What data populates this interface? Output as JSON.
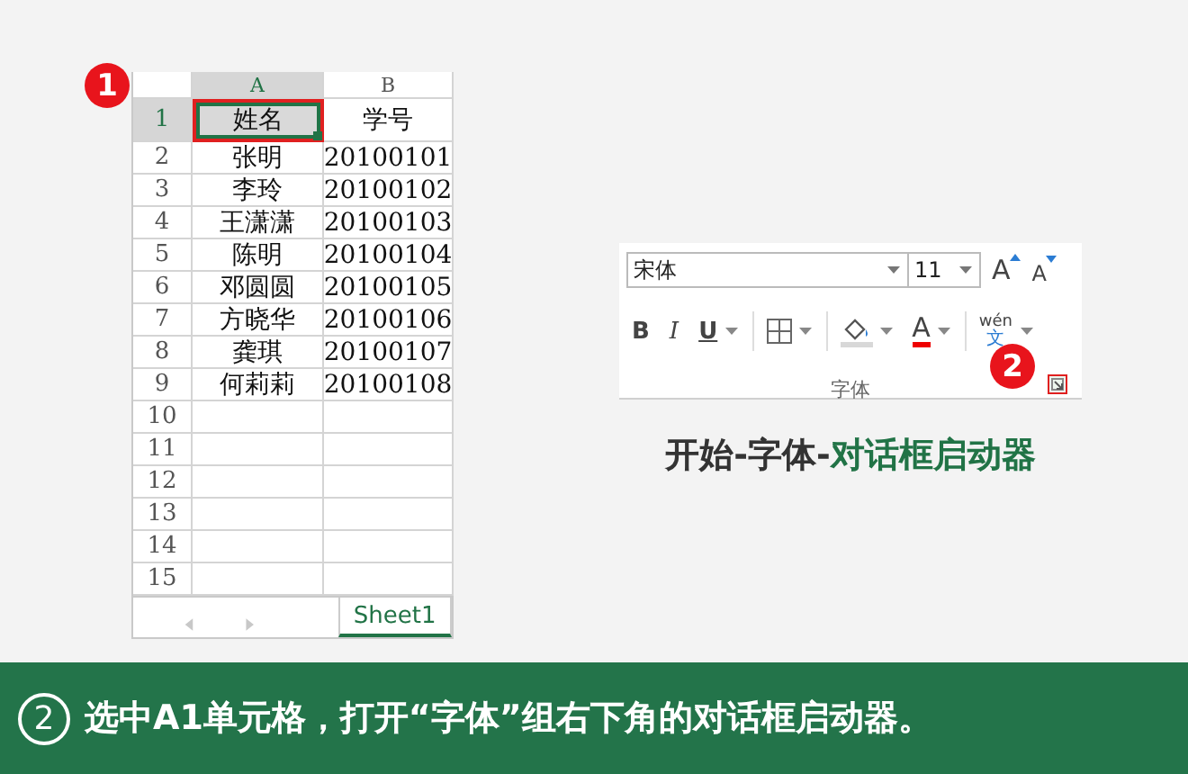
{
  "spreadsheet": {
    "columns": [
      {
        "label": "A",
        "selected": true
      },
      {
        "label": "B",
        "selected": false
      }
    ],
    "rows": [
      {
        "number": "1",
        "selected": true,
        "cells": [
          {
            "text": "姓名",
            "selected": true
          },
          {
            "text": "学号",
            "selected": false
          }
        ]
      },
      {
        "number": "2",
        "selected": false,
        "cells": [
          {
            "text": "张明",
            "selected": false
          },
          {
            "text": "20100101",
            "selected": false
          }
        ]
      },
      {
        "number": "3",
        "selected": false,
        "cells": [
          {
            "text": "李玲",
            "selected": false
          },
          {
            "text": "20100102",
            "selected": false
          }
        ]
      },
      {
        "number": "4",
        "selected": false,
        "cells": [
          {
            "text": "王潇潇",
            "selected": false
          },
          {
            "text": "20100103",
            "selected": false
          }
        ]
      },
      {
        "number": "5",
        "selected": false,
        "cells": [
          {
            "text": "陈明",
            "selected": false
          },
          {
            "text": "20100104",
            "selected": false
          }
        ]
      },
      {
        "number": "6",
        "selected": false,
        "cells": [
          {
            "text": "邓圆圆",
            "selected": false
          },
          {
            "text": "20100105",
            "selected": false
          }
        ]
      },
      {
        "number": "7",
        "selected": false,
        "cells": [
          {
            "text": "方晓华",
            "selected": false
          },
          {
            "text": "20100106",
            "selected": false
          }
        ]
      },
      {
        "number": "8",
        "selected": false,
        "cells": [
          {
            "text": "龚琪",
            "selected": false
          },
          {
            "text": "20100107",
            "selected": false
          }
        ]
      },
      {
        "number": "9",
        "selected": false,
        "cells": [
          {
            "text": "何莉莉",
            "selected": false
          },
          {
            "text": "20100108",
            "selected": false
          }
        ]
      },
      {
        "number": "10",
        "selected": false
      },
      {
        "number": "11",
        "selected": false
      },
      {
        "number": "12",
        "selected": false
      },
      {
        "number": "13",
        "selected": false
      },
      {
        "number": "14",
        "selected": false
      },
      {
        "number": "15",
        "selected": false
      }
    ],
    "sheet_tabs": [
      {
        "label": "Sheet1",
        "selected": true
      }
    ],
    "step_badge": "1"
  },
  "ribbon": {
    "font_name": "宋体",
    "font_size": "11",
    "top_buttons": [
      {
        "kind": "grow",
        "label": "A"
      },
      {
        "kind": "shrink",
        "label": "A"
      }
    ],
    "bottom_buttons": [
      {
        "kind": "bold",
        "label": "B"
      },
      {
        "kind": "italic",
        "label": "I"
      },
      {
        "kind": "underline",
        "label": "U"
      },
      {
        "kind": "borders"
      },
      {
        "kind": "fill"
      },
      {
        "kind": "font-color",
        "label": "A"
      },
      {
        "kind": "phonetic",
        "label": "wén",
        "sub": "文"
      }
    ],
    "group_label": "字体",
    "step_badge": "2"
  },
  "caption": [
    {
      "kind": "plain",
      "text": "开始-字体-"
    },
    {
      "kind": "accent",
      "text": "对话框启动器"
    }
  ],
  "footer": {
    "step": "2",
    "text": "选中A1单元格，打开“字体”组右下角的对话框启动器。"
  }
}
